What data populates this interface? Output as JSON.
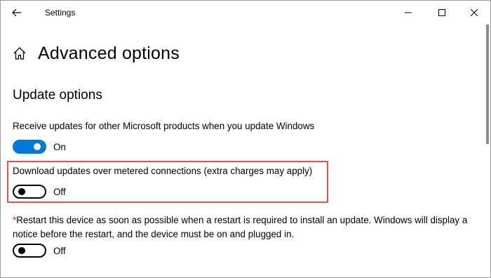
{
  "titlebar": {
    "title": "Settings",
    "back_icon": "arrow-left-icon",
    "minimize_icon": "minimize-icon",
    "maximize_icon": "maximize-icon",
    "close_icon": "close-icon"
  },
  "header": {
    "home_icon": "home-icon",
    "title": "Advanced options"
  },
  "section": {
    "title": "Update options"
  },
  "settings": [
    {
      "label": "Receive updates for other Microsoft products when you update Windows",
      "state": "On",
      "enabled": true
    },
    {
      "label": "Download updates over metered connections (extra charges may apply)",
      "state": "Off",
      "enabled": false
    },
    {
      "asterisk": "*",
      "label": "Restart this device as soon as possible when a restart is required to install an update. Windows will display a notice before the restart, and the device must be on and plugged in.",
      "state": "Off",
      "enabled": false
    }
  ],
  "colors": {
    "accent": "#0078d7",
    "highlight": "#d9534f",
    "asterisk": "#c42b1c"
  }
}
